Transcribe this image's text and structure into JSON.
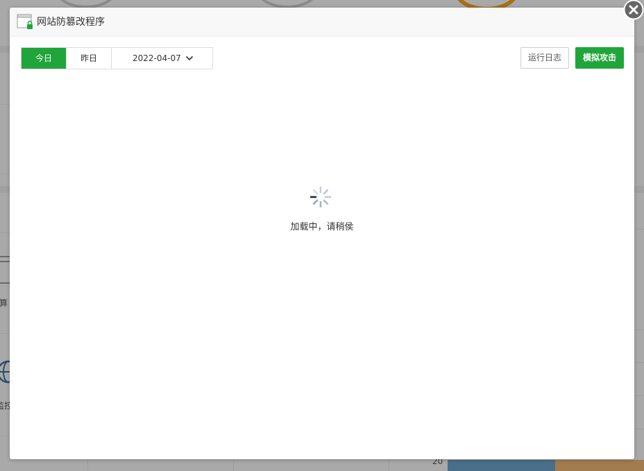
{
  "background": {
    "fragment_labels": [
      "算",
      "监控"
    ],
    "axis_tick": "20"
  },
  "dialog": {
    "title": "网站防篡改程序",
    "tabs": [
      {
        "label": "今日",
        "active": true
      },
      {
        "label": "昨日",
        "active": false
      }
    ],
    "date_value": "2022-04-07",
    "log_button_label": "运行日志",
    "attack_button_label": "模拟攻击",
    "loading_text": "加载中，请稍侯",
    "accent_color": "#20a53a"
  }
}
